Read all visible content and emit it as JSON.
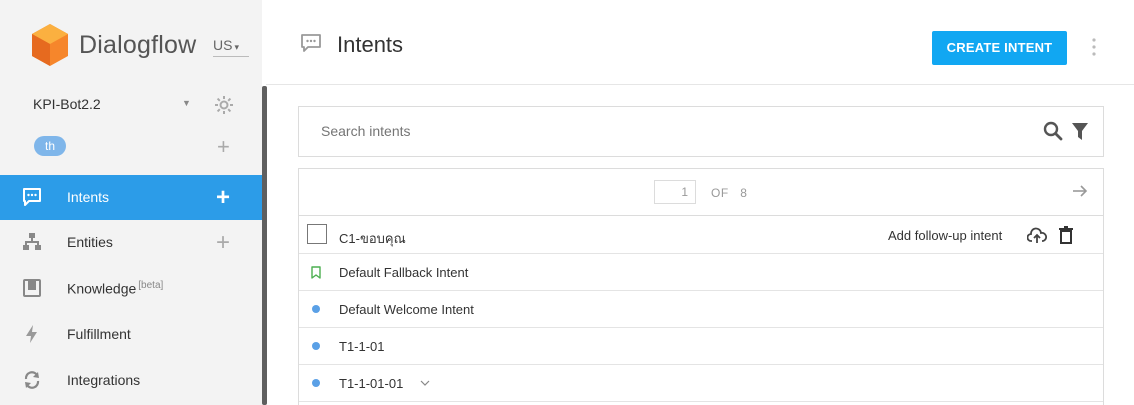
{
  "brand": {
    "name": "Dialogflow",
    "region": "US"
  },
  "agent": {
    "name": "KPI-Bot2.2",
    "language": "th"
  },
  "nav": [
    {
      "label": "Intents",
      "icon": "intents-icon",
      "active": true,
      "has_plus": true
    },
    {
      "label": "Entities",
      "icon": "entities-icon",
      "active": false,
      "has_plus": true
    },
    {
      "label": "Knowledge",
      "badge": "[beta]",
      "icon": "knowledge-icon",
      "active": false,
      "has_plus": false
    },
    {
      "label": "Fulfillment",
      "icon": "fulfillment-icon",
      "active": false,
      "has_plus": false
    },
    {
      "label": "Integrations",
      "icon": "integrations-icon",
      "active": false,
      "has_plus": false
    }
  ],
  "header": {
    "title": "Intents",
    "create_label": "CREATE INTENT"
  },
  "search": {
    "placeholder": "Search intents"
  },
  "pager": {
    "current": "1",
    "of_label": "OF",
    "total": "8"
  },
  "intents": [
    {
      "label": "C1-ขอบคุณ",
      "marker": "checkbox",
      "followup_label": "Add follow-up intent"
    },
    {
      "label": "Default Fallback Intent",
      "marker": "bookmark"
    },
    {
      "label": "Default Welcome Intent",
      "marker": "dot"
    },
    {
      "label": "T1-1-01",
      "marker": "dot"
    },
    {
      "label": "T1-1-01-01",
      "marker": "dot",
      "expandable": true
    }
  ],
  "colors": {
    "accent": "#2c9ce8",
    "create_button": "#11a7f2",
    "logo_orange": "#f6862b",
    "dot_blue": "#5aa0e6",
    "bookmark_green": "#4caf50"
  }
}
